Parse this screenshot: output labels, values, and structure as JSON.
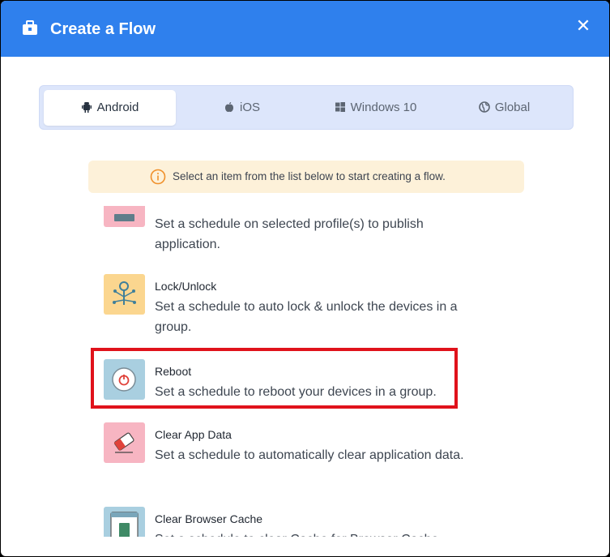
{
  "dialog": {
    "title": "Create a Flow",
    "close_symbol": "✕"
  },
  "tabs": [
    {
      "label": "Android",
      "icon": "android-icon",
      "active": true
    },
    {
      "label": "iOS",
      "icon": "apple-icon",
      "active": false
    },
    {
      "label": "Windows 10",
      "icon": "windows-icon",
      "active": false
    },
    {
      "label": "Global",
      "icon": "globe-icon",
      "active": false
    }
  ],
  "notice": {
    "icon": "info-icon",
    "text": "Select an item from the list below to start creating a flow."
  },
  "items": [
    {
      "name": "",
      "desc": "Set a schedule on selected profile(s) to publish application.",
      "icon": "publish-app-icon",
      "color": "#f7b5c2"
    },
    {
      "name": "Lock/Unlock",
      "desc": "Set a schedule to auto lock & unlock the devices in a group.",
      "icon": "lock-unlock-icon",
      "color": "#fbd68f"
    },
    {
      "name": "Reboot",
      "desc": "Set a schedule to reboot your devices in a group.",
      "icon": "reboot-icon",
      "color": "#a9cfe0"
    },
    {
      "name": "Clear App Data",
      "desc": "Set a schedule to automatically clear application data.",
      "icon": "clear-app-data-icon",
      "color": "#f7b5c2"
    },
    {
      "name": "Clear Browser Cache",
      "desc": "Set a schedule to clear Cache for Browser Cache",
      "icon": "clear-browser-cache-icon",
      "color": "#a9cfe0"
    }
  ],
  "colors": {
    "header": "#2f80ed",
    "highlight": "#e0121b",
    "notice_bg": "#fdf1d9"
  }
}
